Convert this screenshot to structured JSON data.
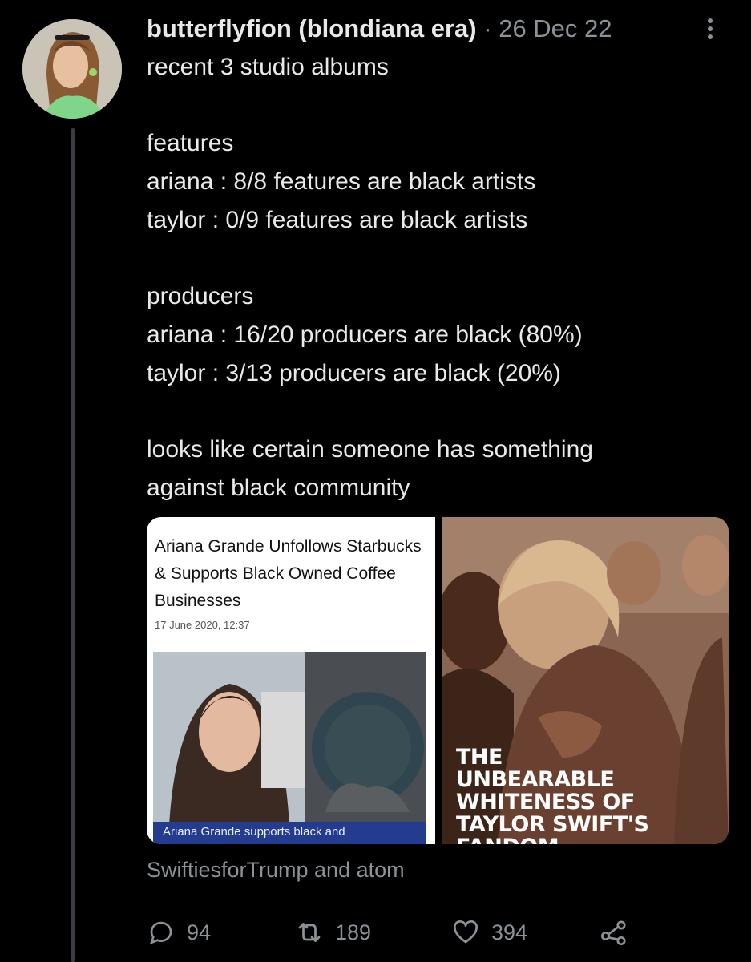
{
  "tweet": {
    "username": "butterflyfion (blondiana era)",
    "separator": "·",
    "date": "26 Dec 22",
    "text": "recent 3 studio albums\n\nfeatures\nariana : 8/8 features are black artists\ntaylor : 0/9 features are black artists\n\nproducers\nariana : 16/20 producers are black (80%)\ntaylor : 3/13 producers are black (20%)\n\nlooks like certain someone has something\nagainst black community",
    "more_icon": "more-vertical-icon"
  },
  "media": {
    "left": {
      "title": "Ariana Grande Unfollows Starbucks & Supports Black Owned Coffee Businesses",
      "date": "17 June 2020, 12:37",
      "caption": "Ariana Grande supports black and"
    },
    "right": {
      "headline": "THE\nUNBEARABLE\nWHITENESS OF\nTAYLOR SWIFT'S\nFANDOM"
    }
  },
  "replying_to": "SwiftiesforTrump and atom",
  "actions": {
    "replies": "94",
    "retweets": "189",
    "likes": "394",
    "icons": [
      "reply-icon",
      "retweet-icon",
      "like-icon",
      "share-icon"
    ]
  },
  "colors": {
    "background": "#000000",
    "text": "#e7e9ea",
    "muted": "#8b9298",
    "caption_bar": "#233c8f"
  }
}
